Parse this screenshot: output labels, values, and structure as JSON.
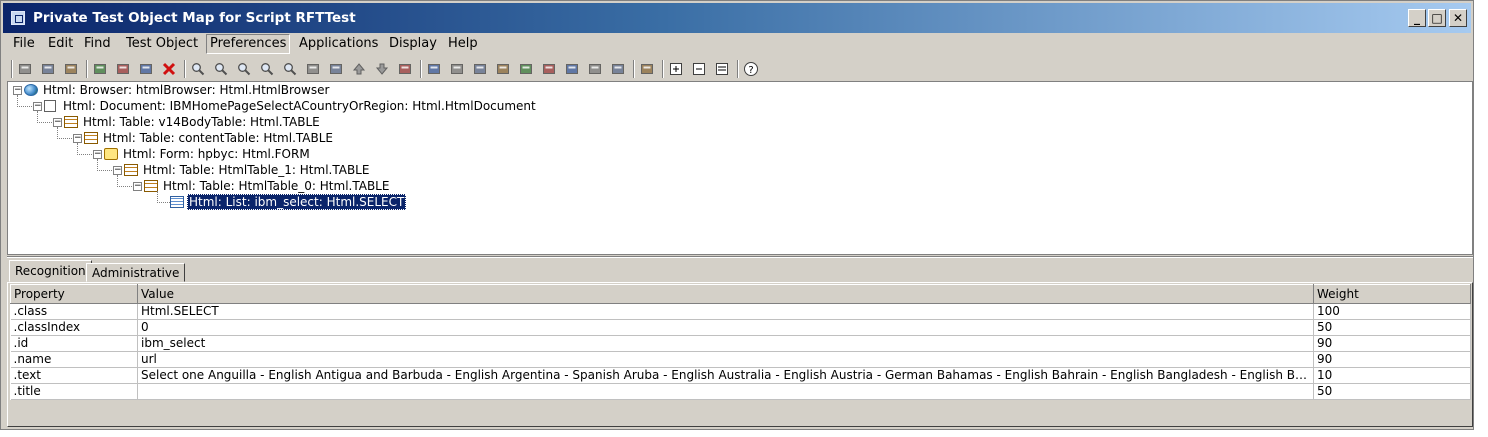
{
  "window": {
    "title": "Private Test Object Map for Script RFTTest",
    "controls": {
      "minimize": "_",
      "maximize": "□",
      "close": "✕"
    }
  },
  "menu": {
    "items": [
      "File",
      "Edit",
      "Find",
      "Test Object",
      "Preferences",
      "Applications",
      "Display",
      "Help"
    ],
    "selected_index": 4
  },
  "toolbar": {
    "buttons": [
      "save-icon",
      "insert-object-icon",
      "undo-icon",
      "cut-icon",
      "copy-icon",
      "paste-icon",
      "delete-icon",
      "find-icon",
      "find-next-icon",
      "find-replace-icon",
      "find-previous-icon",
      "find-matching-icon",
      "filter-icon",
      "sort-icon",
      "move-up-icon",
      "move-down-icon",
      "move-icon",
      "add-object-icon",
      "merge-icon",
      "unify-icon",
      "update-icon",
      "associate-icon",
      "split-icon",
      "edit-properties-icon",
      "highlight-icon",
      "validate-icon",
      "display-icon",
      "expand-all-icon",
      "collapse-all-icon",
      "show-details-icon",
      "help-icon"
    ]
  },
  "tree": {
    "nodes": [
      {
        "label": "Html: Browser: htmlBrowser: Html.HtmlBrowser",
        "icon": "globe-icon"
      },
      {
        "label": "Html: Document: IBMHomePageSelectACountryOrRegion: Html.HtmlDocument",
        "icon": "document-icon"
      },
      {
        "label": "Html: Table: v14BodyTable: Html.TABLE",
        "icon": "table-icon"
      },
      {
        "label": "Html: Table: contentTable: Html.TABLE",
        "icon": "table-icon"
      },
      {
        "label": "Html: Form: hpbyc: Html.FORM",
        "icon": "form-icon"
      },
      {
        "label": "Html: Table: HtmlTable_1: Html.TABLE",
        "icon": "table-icon"
      },
      {
        "label": "Html: Table: HtmlTable_0: Html.TABLE",
        "icon": "table-icon"
      },
      {
        "label": "Html: List: ibm_select: Html.SELECT",
        "icon": "list-icon",
        "selected": true
      }
    ]
  },
  "tabs": [
    {
      "label": "Recognition",
      "active": true
    },
    {
      "label": "Administrative",
      "active": false
    }
  ],
  "properties": {
    "columns": [
      "Property",
      "Value",
      "Weight"
    ],
    "rows": [
      [
        ".class",
        "Html.SELECT",
        "100"
      ],
      [
        ".classIndex",
        "0",
        "50"
      ],
      [
        ".id",
        "ibm_select",
        "90"
      ],
      [
        ".name",
        "url",
        "90"
      ],
      [
        ".text",
        "Select one Anguilla - English Antigua and Barbuda - English Argentina - Spanish Aruba - English Australia - English Austria - German Bahamas - English Bahrain - English Bangladesh - English Barbados - ...",
        "10"
      ],
      [
        ".title",
        "",
        "50"
      ]
    ]
  },
  "colors": {
    "title_start": "#0a246a",
    "title_end": "#a6caf0",
    "selection": "#0a246a",
    "chrome": "#d4d0c8"
  }
}
